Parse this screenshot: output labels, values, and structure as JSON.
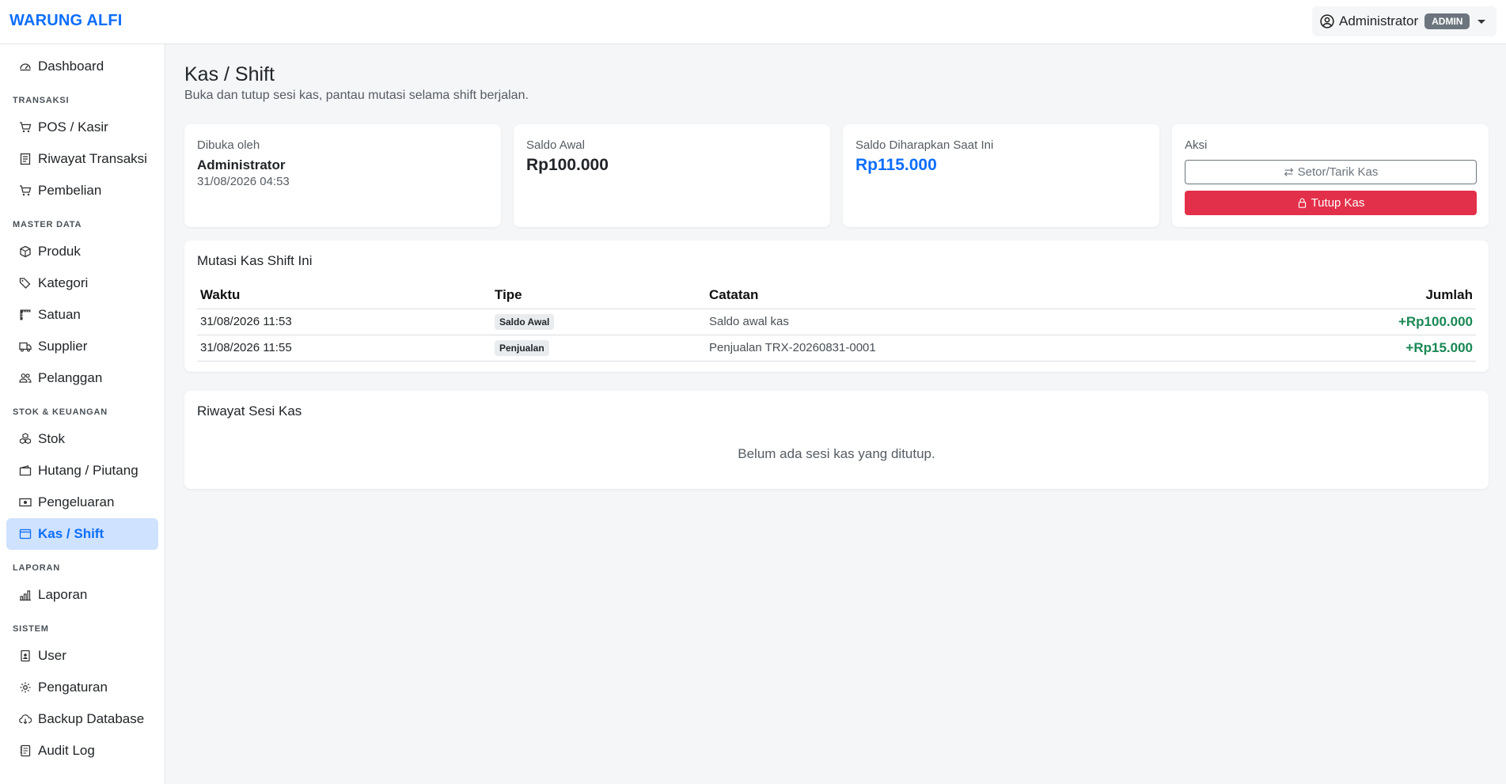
{
  "app": {
    "brand": "WARUNG ALFI"
  },
  "user": {
    "name": "Administrator",
    "role_badge": "ADMIN"
  },
  "sidebar": {
    "dashboard": "Dashboard",
    "sections": {
      "transaksi": "TRANSAKSI",
      "master": "MASTER DATA",
      "stok": "STOK & KEUANGAN",
      "laporan": "LAPORAN",
      "sistem": "SISTEM"
    },
    "items": {
      "pos": "POS / Kasir",
      "riwayat": "Riwayat Transaksi",
      "pembelian": "Pembelian",
      "produk": "Produk",
      "kategori": "Kategori",
      "satuan": "Satuan",
      "supplier": "Supplier",
      "pelanggan": "Pelanggan",
      "stok": "Stok",
      "hutang": "Hutang / Piutang",
      "pengeluaran": "Pengeluaran",
      "kas": "Kas / Shift",
      "laporan": "Laporan",
      "user": "User",
      "pengaturan": "Pengaturan",
      "backup": "Backup Database",
      "audit": "Audit Log"
    },
    "active": "kas"
  },
  "page": {
    "title": "Kas / Shift",
    "subtitle": "Buka dan tutup sesi kas, pantau mutasi selama shift berjalan."
  },
  "stats": {
    "opened_by": {
      "label": "Dibuka oleh",
      "value": "Administrator",
      "time": "31/08/2026 04:53"
    },
    "saldo_awal": {
      "label": "Saldo Awal",
      "value": "Rp100.000"
    },
    "saldo_expected": {
      "label": "Saldo Diharapkan Saat Ini",
      "value": "Rp115.000"
    },
    "actions": {
      "label": "Aksi",
      "setor_label": "Setor/Tarik Kas",
      "tutup_label": "Tutup Kas"
    }
  },
  "mutasi": {
    "title": "Mutasi Kas Shift Ini",
    "headers": {
      "waktu": "Waktu",
      "tipe": "Tipe",
      "catatan": "Catatan",
      "jumlah": "Jumlah"
    },
    "rows": [
      {
        "waktu": "31/08/2026 11:53",
        "tipe": "Saldo Awal",
        "catatan": "Saldo awal kas",
        "jumlah": "+Rp100.000"
      },
      {
        "waktu": "31/08/2026 11:55",
        "tipe": "Penjualan",
        "catatan": "Penjualan TRX-20260831-0001",
        "jumlah": "+Rp15.000"
      }
    ]
  },
  "riwayat": {
    "title": "Riwayat Sesi Kas",
    "empty": "Belum ada sesi kas yang ditutup."
  },
  "colors": {
    "accent": "#0d6efd",
    "danger": "#e3304a",
    "success": "#198754"
  }
}
